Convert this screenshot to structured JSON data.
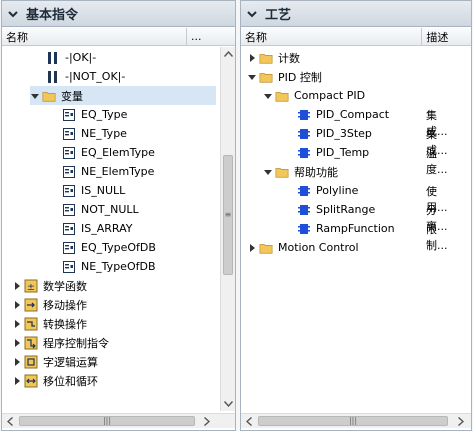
{
  "left_panel": {
    "title": "基本指令",
    "col_name": "名称",
    "col_more": "...",
    "items": [
      {
        "label": "-|OK|-",
        "icon": "contact-icon"
      },
      {
        "label": "-|NOT_OK|-",
        "icon": "contact-icon"
      },
      {
        "label": "变量",
        "icon": "folder-icon",
        "expanded": true
      },
      {
        "label": "EQ_Type",
        "icon": "compare-box-icon"
      },
      {
        "label": "NE_Type",
        "icon": "compare-box-icon"
      },
      {
        "label": "EQ_ElemType",
        "icon": "compare-box-icon"
      },
      {
        "label": "NE_ElemType",
        "icon": "compare-box-icon"
      },
      {
        "label": "IS_NULL",
        "icon": "compare-box-icon"
      },
      {
        "label": "NOT_NULL",
        "icon": "compare-box-icon"
      },
      {
        "label": "IS_ARRAY",
        "icon": "compare-box-icon"
      },
      {
        "label": "EQ_TypeOfDB",
        "icon": "compare-box-icon"
      },
      {
        "label": "NE_TypeOfDB",
        "icon": "compare-box-icon"
      },
      {
        "label": "数学函数",
        "icon": "math-icon"
      },
      {
        "label": "移动操作",
        "icon": "move-icon"
      },
      {
        "label": "转换操作",
        "icon": "convert-icon"
      },
      {
        "label": "程序控制指令",
        "icon": "program-control-icon"
      },
      {
        "label": "字逻辑运算",
        "icon": "word-logic-icon"
      },
      {
        "label": "移位和循环",
        "icon": "shift-rotate-icon"
      }
    ]
  },
  "right_panel": {
    "title": "工艺",
    "col_name": "名称",
    "col_desc": "描述",
    "items": [
      {
        "label": "计数",
        "desc": "",
        "icon": "folder-icon"
      },
      {
        "label": "PID 控制",
        "desc": "",
        "icon": "folder-icon",
        "expanded": true
      },
      {
        "label": "Compact PID",
        "desc": "",
        "icon": "folder-icon",
        "expanded": true
      },
      {
        "label": "PID_Compact",
        "desc": "集成...",
        "icon": "function-block-icon"
      },
      {
        "label": "PID_3Step",
        "desc": "集成...",
        "icon": "function-block-icon"
      },
      {
        "label": "PID_Temp",
        "desc": "温度...",
        "icon": "function-block-icon"
      },
      {
        "label": "帮助功能",
        "desc": "",
        "icon": "folder-icon",
        "expanded": true
      },
      {
        "label": "Polyline",
        "desc": "使用...",
        "icon": "function-block-icon"
      },
      {
        "label": "SplitRange",
        "desc": "分离...",
        "icon": "function-block-icon"
      },
      {
        "label": "RampFunction",
        "desc": "限制...",
        "icon": "function-block-icon"
      },
      {
        "label": "Motion Control",
        "desc": "",
        "icon": "folder-icon"
      }
    ]
  },
  "colors": {
    "header_bg": "#d5dde6",
    "selected_bg": "#d6e6f5",
    "folder": "#f3c659",
    "fb_blue": "#1f4fd6"
  }
}
